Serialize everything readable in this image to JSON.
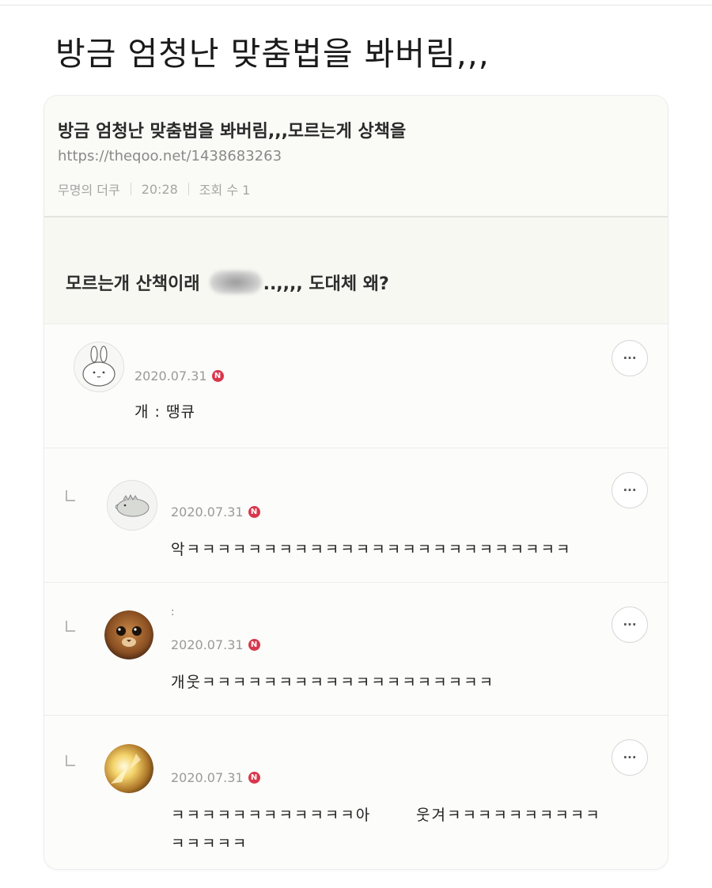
{
  "header": {
    "title": "방금 엄청난 맞춤법을 봐버림,,,"
  },
  "post": {
    "title": "방금 엄청난 맞춤법을 봐버림,,,모르는게 상책을",
    "url": "https://theqoo.net/1438683263",
    "author": "무명의 더쿠",
    "time": "20:28",
    "views": "조회 수 1",
    "body_before": "모르는개 산책이래",
    "body_after": "..,,,, 도대체 왜?"
  },
  "comments": [
    {
      "date": "2020.07.31",
      "badge": "N",
      "text": "개 : 땡큐",
      "more": "···",
      "avatar": "bunny"
    },
    {
      "date": "2020.07.31",
      "badge": "N",
      "text": "악ㅋㅋㅋㅋㅋㅋㅋㅋㅋㅋㅋㅋㅋㅋㅋㅋㅋㅋㅋㅋㅋㅋㅋㅋㅋ",
      "more": "···",
      "avatar": "dino"
    },
    {
      "date": "2020.07.31",
      "badge": "N",
      "text": "개웃ㅋㅋㅋㅋㅋㅋㅋㅋㅋㅋㅋㅋㅋㅋㅋㅋㅋㅋㅋ",
      "more": "···",
      "avatar": "cat",
      "name_hint": ":"
    },
    {
      "date": "2020.07.31",
      "badge": "N",
      "text_line1": "ㅋㅋㅋㅋㅋㅋㅋㅋㅋㅋㅋㅋ아",
      "text_line1b": "웃겨ㅋㅋㅋㅋㅋㅋㅋㅋㅋㅋ",
      "text_line2": "ㅋㅋㅋㅋㅋ",
      "more": "···",
      "avatar": "light"
    }
  ]
}
